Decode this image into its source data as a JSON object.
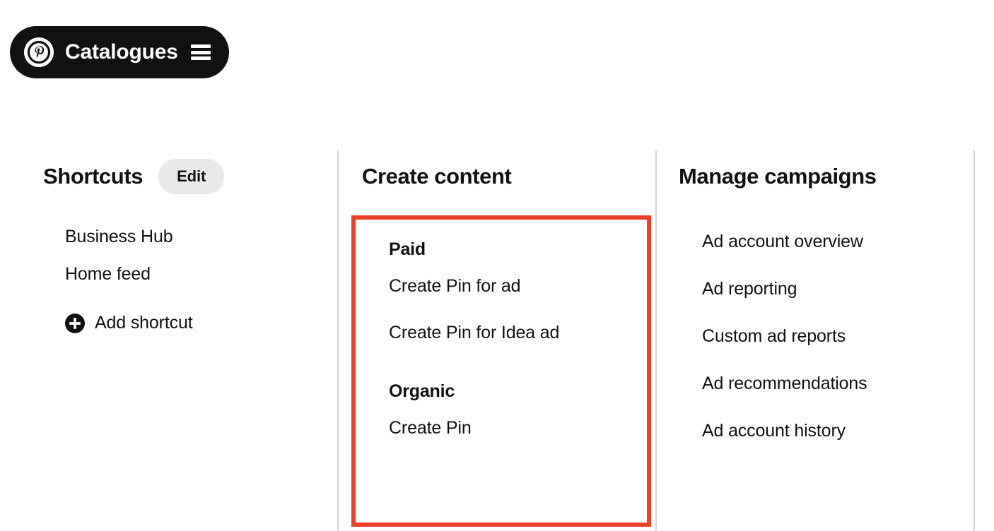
{
  "header": {
    "logo_icon": "pinterest-logo-icon",
    "title": "Catalogues",
    "menu_icon": "hamburger-menu-icon"
  },
  "colors": {
    "highlight_box": "#e8402a",
    "header_pill_bg": "#111111",
    "edit_button_bg": "#e9e9e9",
    "divider": "#d4d4d4",
    "page_bg": "#ffffff"
  },
  "columns": {
    "shortcuts": {
      "title": "Shortcuts",
      "edit_label": "Edit",
      "items": [
        {
          "label": "Business Hub"
        },
        {
          "label": "Home feed"
        }
      ],
      "add_shortcut": {
        "label": "Add shortcut",
        "icon": "plus-circle-icon"
      }
    },
    "create_content": {
      "title": "Create content",
      "groups": [
        {
          "label": "Paid",
          "items": [
            {
              "label": "Create Pin for ad"
            },
            {
              "label": "Create Pin for Idea ad"
            }
          ]
        },
        {
          "label": "Organic",
          "items": [
            {
              "label": "Create Pin"
            }
          ]
        }
      ]
    },
    "manage_campaigns": {
      "title": "Manage campaigns",
      "items": [
        {
          "label": "Ad account overview"
        },
        {
          "label": "Ad reporting"
        },
        {
          "label": "Custom ad reports"
        },
        {
          "label": "Ad recommendations"
        },
        {
          "label": "Ad account history"
        }
      ]
    }
  }
}
